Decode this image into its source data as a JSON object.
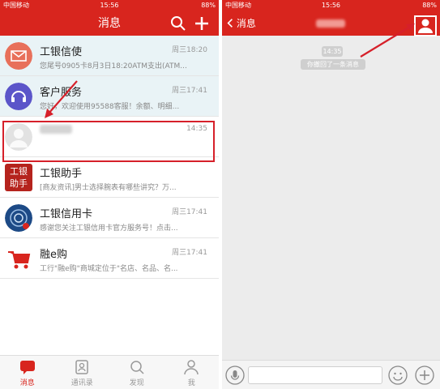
{
  "left": {
    "status": {
      "carrier": "中国移动",
      "time": "15:56",
      "battery": "88%"
    },
    "title": "消息",
    "conversations": [
      {
        "name": "工银信使",
        "time": "周三18:20",
        "preview": "您尾号0905卡8月3日18:20ATM支出(ATM..."
      },
      {
        "name": "客户服务",
        "time": "周三17:41",
        "preview": "您好，欢迎使用95588客服！余额、明细..."
      },
      {
        "name": "",
        "time": "14:35",
        "preview": ""
      },
      {
        "name": "工银助手",
        "time": "",
        "preview": "[商友资讯]男士选择腕表有哪些讲究？万..."
      },
      {
        "name": "工银信用卡",
        "time": "周三17:41",
        "preview": "感谢您关注工银信用卡官方服务号！点击..."
      },
      {
        "name": "融e购",
        "time": "周三17:41",
        "preview": "工行\"融e购\"商城定位于\"名店、名品、名..."
      }
    ],
    "avatar_labels": {
      "assistant": "工银\n助手"
    },
    "tabs": [
      {
        "label": "消息",
        "active": true
      },
      {
        "label": "通讯录",
        "active": false
      },
      {
        "label": "发现",
        "active": false
      },
      {
        "label": "我",
        "active": false
      }
    ]
  },
  "right": {
    "status": {
      "carrier": "中国移动",
      "time": "15:56",
      "battery": "88%"
    },
    "back_label": "消息",
    "chat_time": "14:35",
    "chat_notice": "你撤回了一条消息"
  },
  "colors": {
    "brand_red": "#d8251e",
    "highlight_red": "#d6202a",
    "tint_row": "#e9f3f6"
  }
}
